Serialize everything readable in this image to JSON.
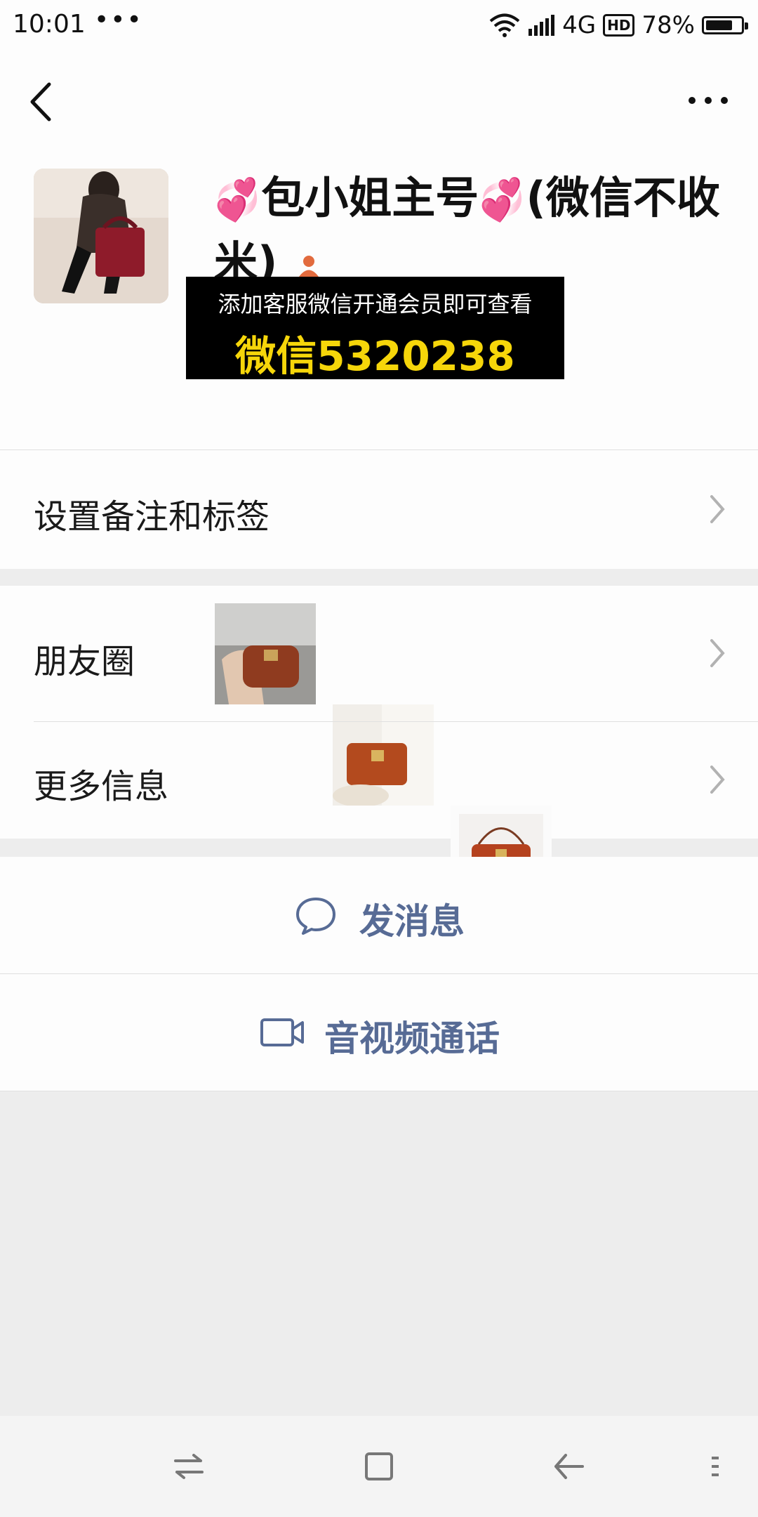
{
  "status_bar": {
    "time": "10:01",
    "dots": "•••",
    "network": "4G",
    "hd": "HD",
    "battery": "78%",
    "battery_level": 0.78
  },
  "header": {
    "back_icon": "chevron-left-icon",
    "more_icon": "more-icon"
  },
  "profile": {
    "name_part1": "包小姐主号",
    "name_part2": "(微信不收米)",
    "heart_icon": "💞",
    "promo_line1": "添加客服微信开通会员即可查看",
    "promo_line2": "微信5320238",
    "promo_color": "#f6d60a"
  },
  "rows": {
    "remark": "设置备注和标签",
    "moments": "朋友圈",
    "more_info": "更多信息"
  },
  "actions": {
    "message": "发消息",
    "call": "音视频通话",
    "accent": "#576b95"
  },
  "navbar": {
    "icons": [
      "switch-icon",
      "home-icon",
      "back-arrow-icon",
      "menu-icon"
    ]
  }
}
